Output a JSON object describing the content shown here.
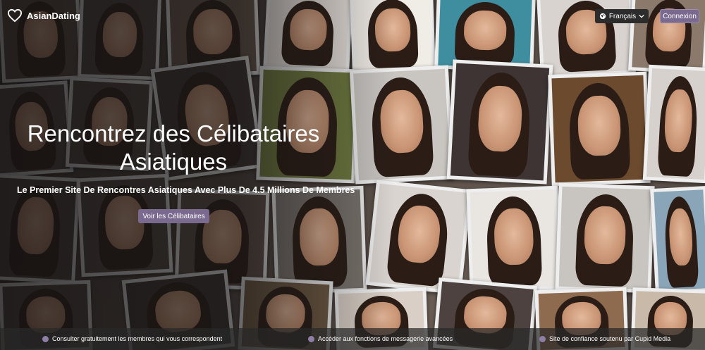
{
  "header": {
    "logo_text": "AsianDating",
    "language_label": "Français",
    "login_label": "Connexion"
  },
  "hero": {
    "title_line1": "Rencontrez des Célibataires",
    "title_line2": "Asiatiques",
    "subtitle": "Le Premier Site De Rencontres Asiatiques Avec Plus De 4.5 Millions De Membres",
    "cta_label": "Voir les Célibataires"
  },
  "features": [
    {
      "label": "Consulter gratuitement les membres qui vous correspondent"
    },
    {
      "label": "Accéder aux fonctions de messagerie avancées"
    },
    {
      "label": "Site de confiance soutenu par Cupid Media"
    }
  ],
  "colors": {
    "accent": "#7b6a8f",
    "dot": "#8f7ea6"
  },
  "icons": {
    "logo": "heart-icon",
    "language": "globe-icon",
    "dropdown": "chevron-down-icon",
    "bullet": "dot-icon"
  }
}
